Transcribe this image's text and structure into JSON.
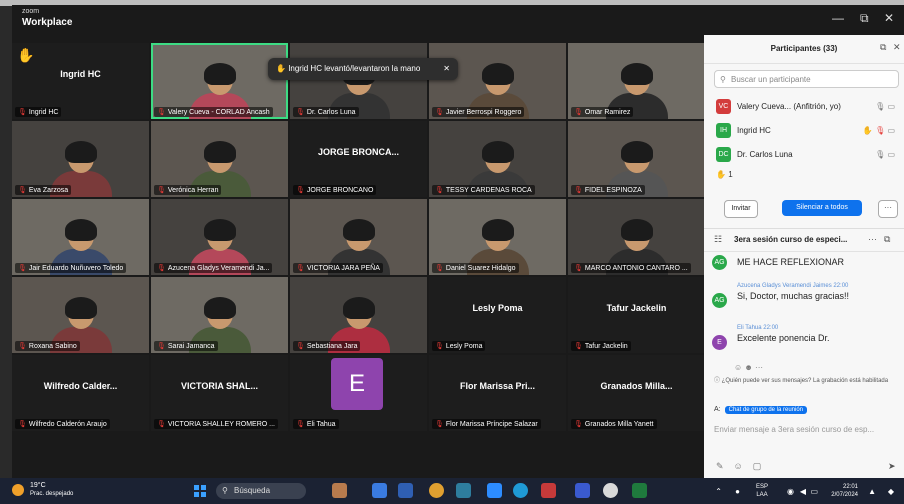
{
  "app": {
    "small": "zoom",
    "name": "Workplace"
  },
  "window_controls": {
    "minimize": "—",
    "restore": "⧉",
    "close": "✕"
  },
  "toast": {
    "text": "Ingrid HC levantó/levantaron la mano",
    "close": "✕"
  },
  "tiles": [
    {
      "name": "Ingrid HC",
      "label": "Ingrid HC",
      "type": "name"
    },
    {
      "label": "Valery Cueva - CORLAD Ancash",
      "type": "video",
      "speaking": true
    },
    {
      "label": "Dr. Carlos Luna",
      "type": "video"
    },
    {
      "label": "Javier Berrospi Roggero",
      "type": "video"
    },
    {
      "label": "Omar Ramirez",
      "type": "video"
    },
    {
      "label": "Eva Zarzosa",
      "type": "video"
    },
    {
      "label": "Verónica Herran",
      "type": "video"
    },
    {
      "name": "JORGE BRONCA...",
      "label": "JORGE BRONCANO",
      "type": "name"
    },
    {
      "label": "TESSY CARDENAS ROCA",
      "type": "video"
    },
    {
      "label": "FIDEL ESPINOZA",
      "type": "video"
    },
    {
      "label": "Jair Eduardo Nuñuvero Toledo",
      "type": "video"
    },
    {
      "label": "Azucena Gladys Veramendi Ja...",
      "type": "video"
    },
    {
      "label": "VICTORIA JARA PEÑA",
      "type": "video"
    },
    {
      "label": "Daniel Suarez Hidalgo",
      "type": "video"
    },
    {
      "label": "MARCO ANTONIO CANTARO ...",
      "type": "video"
    },
    {
      "label": "Roxana Sabino",
      "type": "video"
    },
    {
      "label": "Sarai Jamanca",
      "type": "video"
    },
    {
      "label": "Sebastiana Jara",
      "type": "video"
    },
    {
      "name": "Lesly Poma",
      "label": "Lesly Poma",
      "type": "name"
    },
    {
      "name": "Tafur Jackelin",
      "label": "Tafur Jackelin",
      "type": "name"
    },
    {
      "name": "Wilfredo Calder...",
      "label": "Wilfredo Calderón Araujo",
      "type": "name"
    },
    {
      "name": "VICTORIA SHAL...",
      "label": "VICTORIA SHALLEY ROMERO ...",
      "type": "name"
    },
    {
      "avatar": "E",
      "label": "Eli Tahua",
      "type": "avatar"
    },
    {
      "name": "Flor Marissa Pri...",
      "label": "Flor Marissa Príncipe Salazar",
      "type": "name"
    },
    {
      "name": "Granados Milla...",
      "label": "Granados Milla Yanett",
      "type": "name"
    }
  ],
  "participants_panel": {
    "title": "Participantes (33)",
    "search_placeholder": "Buscar un participante",
    "participants": [
      {
        "initials": "VC",
        "name": "Valery Cueva... (Anfitrión, yo)",
        "color": "#d33c3c"
      },
      {
        "initials": "IH",
        "name": "Ingrid HC",
        "color": "#2aa84a"
      },
      {
        "initials": "DC",
        "name": "Dr. Carlos Luna",
        "color": "#2aa84a"
      }
    ],
    "raised_count": "1",
    "invite_label": "Invitar",
    "silence_label": "Silenciar a todos",
    "more_label": "···"
  },
  "chat": {
    "title": "3era sesión curso de especi...",
    "messages": [
      {
        "text": "ME HACE REFLEXIONAR",
        "initials": "AG",
        "color": "#2aa84a"
      },
      {
        "sender": "Azucena Gladys Veramendi Jaimes 22:00",
        "initials": "AG",
        "text": "Si, Doctor, muchas gracias!!",
        "color": "#2aa84a"
      },
      {
        "sender": "Eli Tahua 22:00",
        "initials": "E",
        "text": "Excelente ponencia Dr.",
        "color": "#8e44ad"
      }
    ],
    "notice": "¿Quién puede ver sus mensajes? La grabación está habilitada",
    "recipient_prefix": "A:",
    "recipient": "Chat de grupo de la reunión",
    "composer_placeholder": "Enviar mensaje a 3era sesión curso de esp..."
  },
  "taskbar": {
    "temperature": "19°C",
    "weather": "Prac. despejado",
    "search": "Búsqueda",
    "lang_top": "ESP",
    "lang_bottom": "LAA",
    "time": "22:01",
    "date": "2/07/2024"
  }
}
